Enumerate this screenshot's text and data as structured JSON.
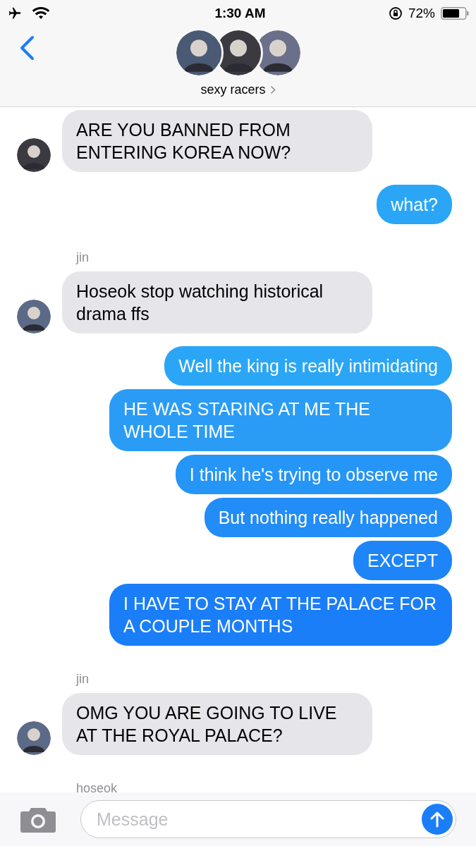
{
  "status_bar": {
    "time": "1:30 AM",
    "battery": "72%"
  },
  "header": {
    "title": "sexy racers"
  },
  "groups": [
    {
      "kind": "incoming",
      "messages": [
        "ARE YOU BANNED FROM ENTERING KOREA NOW?"
      ]
    },
    {
      "kind": "outgoing",
      "messages": [
        "what?"
      ]
    },
    {
      "kind": "incoming",
      "sender": "jin",
      "messages": [
        "Hoseok stop watching historical drama ffs"
      ]
    },
    {
      "kind": "outgoing",
      "messages": [
        "Well the king is really intimidating",
        "HE WAS STARING AT ME THE WHOLE TIME",
        "I think he's trying to observe me",
        "But nothing really happened",
        "EXCEPT",
        "I HAVE TO STAY AT THE PALACE FOR A COUPLE MONTHS"
      ]
    },
    {
      "kind": "incoming",
      "sender": "jin",
      "messages": [
        "OMG YOU ARE GOING TO LIVE AT THE ROYAL PALACE?"
      ]
    },
    {
      "kind": "incoming",
      "sender": "hoseok"
    }
  ],
  "composer": {
    "placeholder": "Message"
  }
}
